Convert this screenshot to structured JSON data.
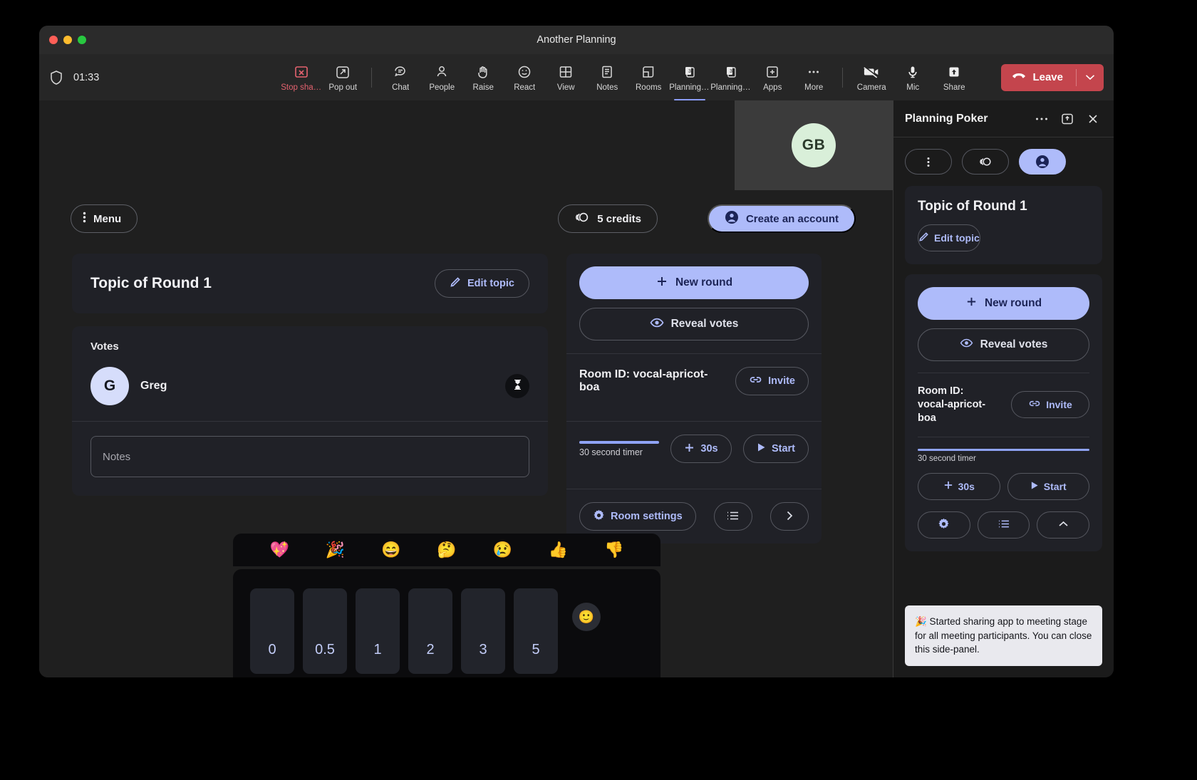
{
  "window": {
    "title": "Another Planning"
  },
  "toolbar": {
    "timer": "01:33",
    "items": [
      {
        "label": "Stop sharing",
        "icon": "stop-sharing-icon"
      },
      {
        "label": "Pop out",
        "icon": "pop-out-icon"
      },
      {
        "label": "Chat",
        "icon": "chat-icon"
      },
      {
        "label": "People",
        "icon": "people-icon"
      },
      {
        "label": "Raise",
        "icon": "raise-hand-icon"
      },
      {
        "label": "React",
        "icon": "react-smiley-icon"
      },
      {
        "label": "View",
        "icon": "view-grid-icon"
      },
      {
        "label": "Notes",
        "icon": "notes-icon"
      },
      {
        "label": "Rooms",
        "icon": "rooms-icon"
      },
      {
        "label": "Planning P...",
        "icon": "planning-poker-icon"
      },
      {
        "label": "Planning P...",
        "icon": "planning-poker-icon"
      },
      {
        "label": "Apps",
        "icon": "apps-plus-icon"
      },
      {
        "label": "More",
        "icon": "more-dots-icon"
      },
      {
        "label": "Camera",
        "icon": "camera-off-icon"
      },
      {
        "label": "Mic",
        "icon": "mic-icon"
      },
      {
        "label": "Share",
        "icon": "share-up-icon"
      }
    ],
    "leave_label": "Leave"
  },
  "stage": {
    "self_tile_initials": "GB",
    "menu_label": "Menu",
    "credits_label": "5 credits",
    "create_account_label": "Create an account",
    "topic": {
      "title": "Topic of Round 1",
      "edit_label": "Edit topic"
    },
    "votes": {
      "heading": "Votes",
      "rows": [
        {
          "initial": "G",
          "name": "Greg",
          "status_icon": "hourglass"
        }
      ]
    },
    "notes_placeholder": "Notes",
    "actions": {
      "new_round_label": "New round",
      "reveal_votes_label": "Reveal votes",
      "room_id_label": "Room ID: vocal-apricot-boa",
      "invite_label": "Invite",
      "timer_caption": "30 second timer",
      "add_30s_label": "30s",
      "start_label": "Start",
      "room_settings_label": "Room settings"
    },
    "emoji_bar": [
      "💖",
      "🎉",
      "😄",
      "🤔",
      "😢",
      "👍",
      "👎"
    ],
    "cards": [
      "0",
      "0.5",
      "1",
      "2",
      "3",
      "5"
    ],
    "card_emoji_button": "🙂"
  },
  "sidepanel": {
    "title": "Planning Poker",
    "topic_title": "Topic of Round 1",
    "edit_topic_label": "Edit topic",
    "new_round_label": "New round",
    "reveal_votes_label": "Reveal votes",
    "room_id_label": "Room ID: vocal-apricot-boa",
    "invite_label": "Invite",
    "timer_caption": "30 second timer",
    "add_30s_label": "30s",
    "start_label": "Start",
    "toast": "🎉 Started sharing app to meeting stage for all meeting participants. You can close this side-panel."
  },
  "colors": {
    "accent": "#aebbfa",
    "danger": "#c4454d",
    "panel": "#202127",
    "stage": "#1f1f1f"
  }
}
